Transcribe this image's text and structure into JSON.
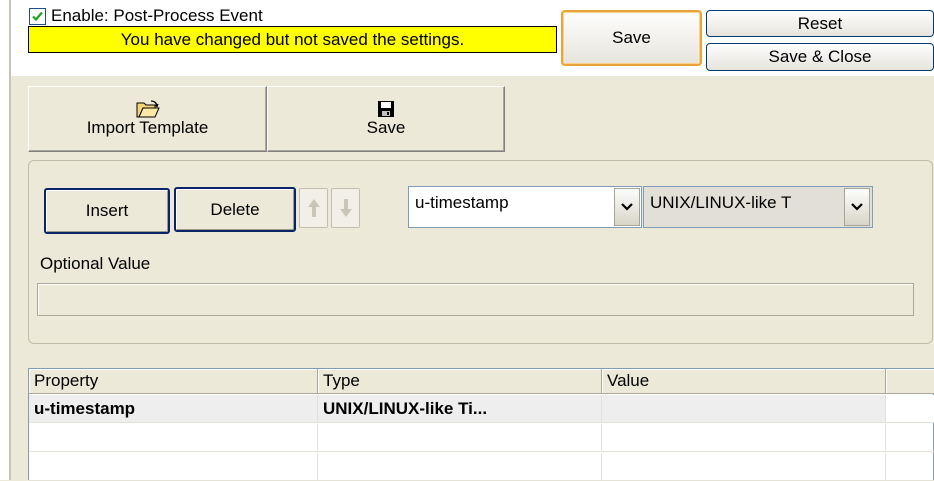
{
  "header": {
    "enable_checkbox": {
      "label": "Enable: Post-Process Event",
      "checked": true
    },
    "warning_text": "You have changed but not saved the settings.",
    "save_label": "Save",
    "reset_label": "Reset",
    "save_close_label": "Save & Close"
  },
  "toolbar": {
    "import_label": "Import Template",
    "import_icon": "folder-open-icon",
    "save_label": "Save",
    "save_icon": "floppy-disk-icon"
  },
  "editor": {
    "insert_label": "Insert",
    "delete_label": "Delete",
    "up_icon": "arrow-up-icon",
    "down_icon": "arrow-down-icon",
    "property_select": {
      "value": "u-timestamp"
    },
    "type_select": {
      "value": "UNIX/LINUX-like T"
    },
    "optional_value_label": "Optional Value",
    "optional_value": ""
  },
  "grid": {
    "columns": [
      "Property",
      "Type",
      "Value"
    ],
    "rows": [
      {
        "property": "u-timestamp",
        "type": "UNIX/LINUX-like Ti...",
        "value": ""
      },
      {
        "property": "",
        "type": "",
        "value": ""
      },
      {
        "property": "",
        "type": "",
        "value": ""
      }
    ]
  },
  "colors": {
    "warning_bg": "#ffff00",
    "focus_border": "#e8a33d",
    "window_bg": "#ece9d8",
    "button_border": "#0a246a"
  }
}
